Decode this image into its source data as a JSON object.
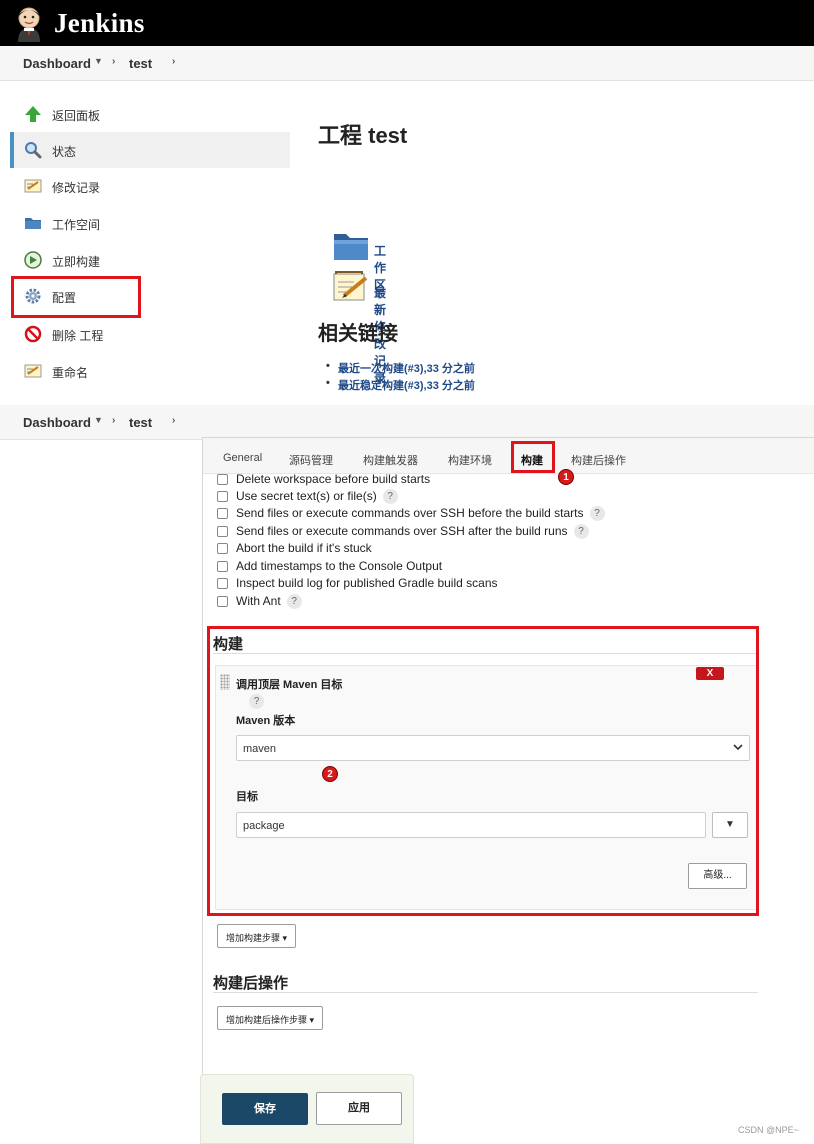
{
  "app": {
    "brand": "Jenkins"
  },
  "breadcrumb": {
    "dashboard": "Dashboard",
    "caret": "▼",
    "separator": "›",
    "project": "test"
  },
  "sidebar": {
    "items": [
      {
        "label": "返回面板",
        "icon": "arrow-up-icon"
      },
      {
        "label": "状态",
        "icon": "search-icon"
      },
      {
        "label": "修改记录",
        "icon": "notepad-icon"
      },
      {
        "label": "工作空间",
        "icon": "folder-icon"
      },
      {
        "label": "立即构建",
        "icon": "build-clock-icon"
      },
      {
        "label": "配置",
        "icon": "gear-icon"
      },
      {
        "label": "删除 工程",
        "icon": "no-entry-icon"
      },
      {
        "label": "重命名",
        "icon": "notepad-icon"
      }
    ]
  },
  "project": {
    "title": "工程 test",
    "workspace_link": "工作区",
    "changes_link": "最新修改记录",
    "related_title": "相关链接",
    "related_links": [
      "最近一次构建(#3),33 分之前",
      "最近稳定构建(#3),33 分之前"
    ]
  },
  "config": {
    "tabs": [
      "General",
      "源码管理",
      "构建触发器",
      "构建环境",
      "构建",
      "构建后操作"
    ],
    "active_tab": "构建",
    "help_mark": "?",
    "options": [
      {
        "label": "Delete workspace before build starts",
        "help": false
      },
      {
        "label": "Use secret text(s) or file(s)",
        "help": true
      },
      {
        "label": "Send files or execute commands over SSH before the build starts",
        "help": true
      },
      {
        "label": "Send files or execute commands over SSH after the build runs",
        "help": true
      },
      {
        "label": "Abort the build if it's stuck",
        "help": false
      },
      {
        "label": "Add timestamps to the Console Output",
        "help": false
      },
      {
        "label": "Inspect build log for published Gradle build scans",
        "help": false
      },
      {
        "label": "With Ant",
        "help": true
      }
    ],
    "build_section_title": "构建",
    "step": {
      "name": "调用顶层 Maven 目标",
      "delete_label": "X",
      "maven_version_label": "Maven 版本",
      "maven_version_value": "maven",
      "goals_label": "目标",
      "goals_value": "package",
      "dropdown_glyph": "▼",
      "advanced_label": "高级..."
    },
    "add_build_step": "增加构建步骤 ▾",
    "post_build_title": "构建后操作",
    "add_post_build_step": "增加构建后操作步骤 ▾",
    "save_label": "保存",
    "apply_label": "应用"
  },
  "annotations": {
    "badge_1": "1",
    "badge_2": "2"
  },
  "watermark": "CSDN @NPE~",
  "colors": {
    "header": "#000000",
    "highlight": "#e0141a",
    "link": "#204a87",
    "save": "#1b4866"
  }
}
